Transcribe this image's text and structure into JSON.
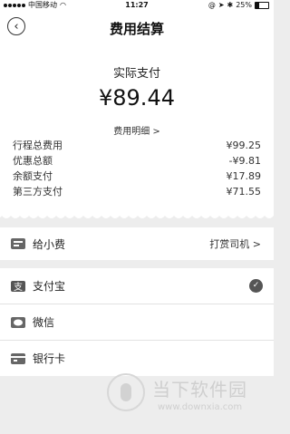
{
  "status_bar": {
    "carrier": "中国移动",
    "time": "11:27",
    "battery": "25%"
  },
  "nav": {
    "title": "费用结算"
  },
  "summary": {
    "label": "实际支付",
    "amount": "¥89.44",
    "detail_link": "费用明细 >",
    "rows": [
      {
        "label": "行程总费用",
        "value": "¥99.25"
      },
      {
        "label": "优惠总额",
        "value": "-¥9.81"
      },
      {
        "label": "余额支付",
        "value": "¥17.89"
      },
      {
        "label": "第三方支付",
        "value": "¥71.55"
      }
    ]
  },
  "tip": {
    "label": "给小费",
    "action": "打赏司机 >"
  },
  "payment_methods": [
    {
      "label": "支付宝",
      "selected": true,
      "icon": "alipay-icon"
    },
    {
      "label": "微信",
      "selected": false,
      "icon": "wechat-icon"
    },
    {
      "label": "银行卡",
      "selected": false,
      "icon": "bank-card-icon"
    }
  ],
  "watermark": {
    "text": "当下软件园",
    "url": "www.downxia.com"
  }
}
